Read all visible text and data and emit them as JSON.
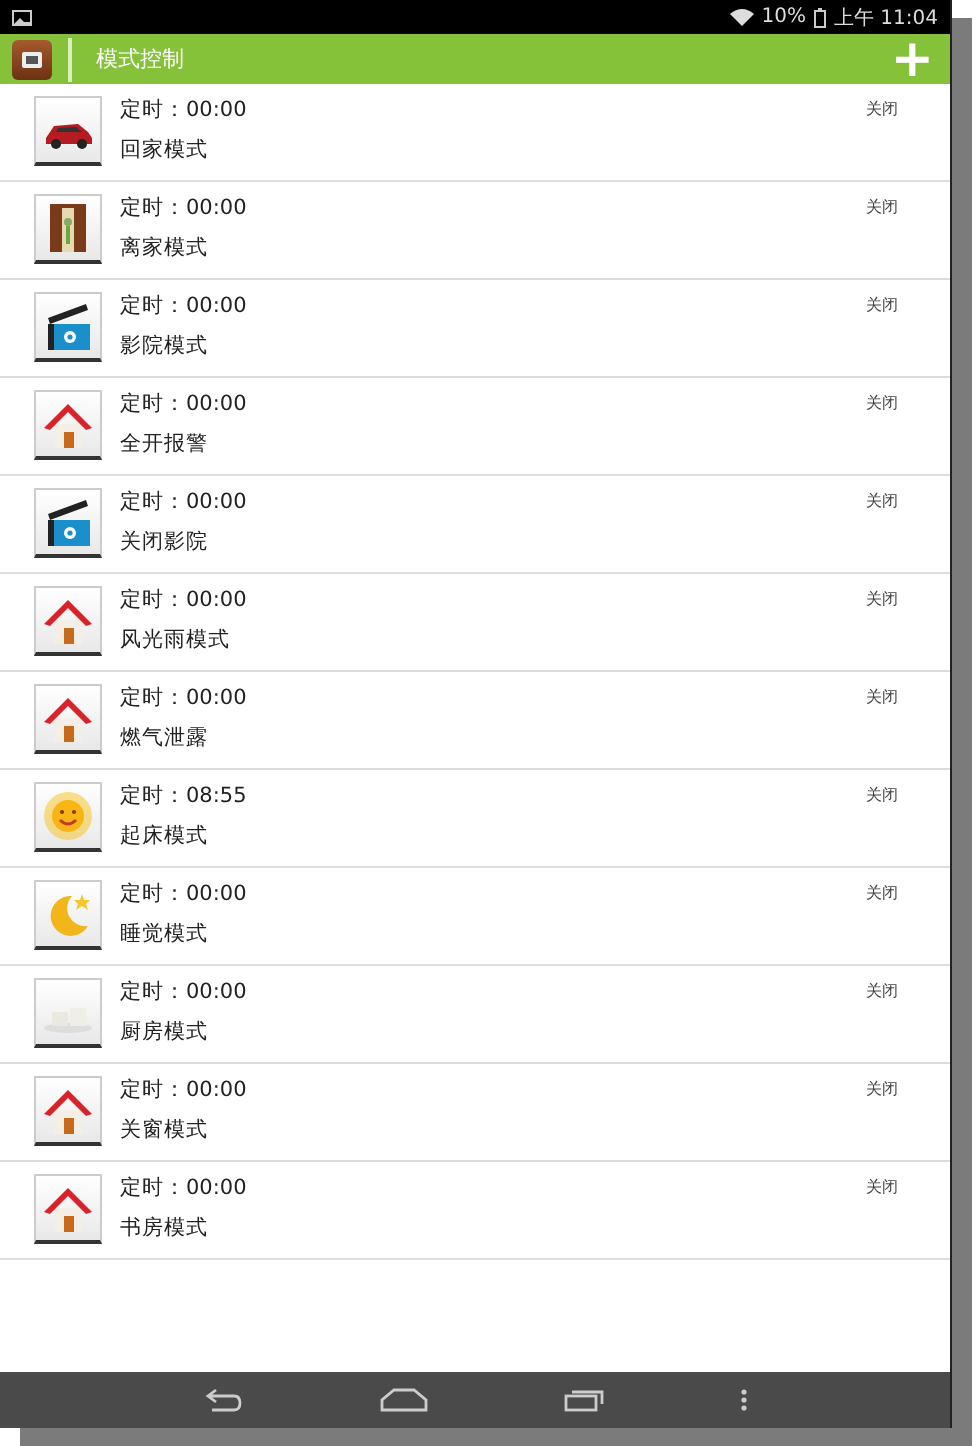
{
  "status_bar": {
    "battery": "10%",
    "time": "上午 11:04"
  },
  "app_bar": {
    "title": "模式控制",
    "add": "+"
  },
  "modes": [
    {
      "kind": "car",
      "timer": "定时：00:00",
      "name": "回家模式",
      "state": "关闭"
    },
    {
      "kind": "door",
      "timer": "定时：00:00",
      "name": "离家模式",
      "state": "关闭"
    },
    {
      "kind": "clapper",
      "timer": "定时：00:00",
      "name": "影院模式",
      "state": "关闭"
    },
    {
      "kind": "house",
      "timer": "定时：00:00",
      "name": "全开报警",
      "state": "关闭"
    },
    {
      "kind": "clapper",
      "timer": "定时：00:00",
      "name": "关闭影院",
      "state": "关闭"
    },
    {
      "kind": "house",
      "timer": "定时：00:00",
      "name": "风光雨模式",
      "state": "关闭"
    },
    {
      "kind": "house",
      "timer": "定时：00:00",
      "name": "燃气泄露",
      "state": "关闭"
    },
    {
      "kind": "sun",
      "timer": "定时：08:55",
      "name": "起床模式",
      "state": "关闭"
    },
    {
      "kind": "moon",
      "timer": "定时：00:00",
      "name": "睡觉模式",
      "state": "关闭"
    },
    {
      "kind": "cups",
      "timer": "定时：00:00",
      "name": "厨房模式",
      "state": "关闭"
    },
    {
      "kind": "house",
      "timer": "定时：00:00",
      "name": "关窗模式",
      "state": "关闭"
    },
    {
      "kind": "house",
      "timer": "定时：00:00",
      "name": "书房模式",
      "state": "关闭"
    }
  ]
}
